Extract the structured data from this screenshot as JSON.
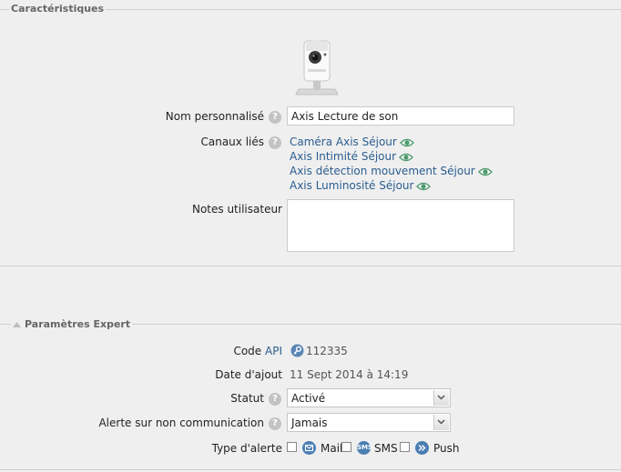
{
  "characteristics": {
    "legend": "Caractéristiques",
    "custom_name": {
      "label": "Nom personnalisé",
      "value": "Axis Lecture de son"
    },
    "linked_channels": {
      "label": "Canaux liés",
      "items": [
        "Caméra Axis Séjour",
        "Axis Intimité Séjour",
        "Axis détection mouvement Séjour",
        "Axis Luminosité Séjour"
      ]
    },
    "user_notes": {
      "label": "Notes utilisateur",
      "value": ""
    }
  },
  "expert": {
    "legend": "Paramètres Expert",
    "code": {
      "label": "Code",
      "api_link": "API",
      "value": "112335"
    },
    "date_added": {
      "label": "Date d'ajout",
      "value": "11 Sept 2014 à 14:19"
    },
    "status": {
      "label": "Statut",
      "selected": "Activé"
    },
    "alert_no_comm": {
      "label": "Alerte sur non communication",
      "selected": "Jamais"
    },
    "alert_type": {
      "label": "Type d'alerte",
      "options": [
        {
          "label": "Mail",
          "icon": "mail-icon",
          "checked": false
        },
        {
          "label": "SMS",
          "icon": "sms-icon",
          "checked": false
        },
        {
          "label": "Push",
          "icon": "push-icon",
          "checked": false
        }
      ]
    }
  },
  "icon_texts": {
    "sms": "SMS",
    "help": "?"
  }
}
